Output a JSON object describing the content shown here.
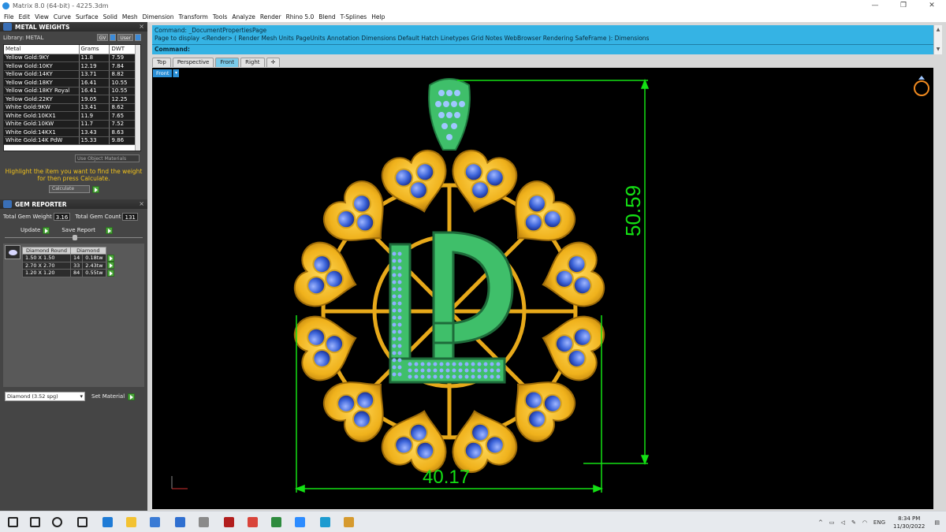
{
  "window": {
    "title": "Matrix 8.0 (64-bit) - 4225.3dm",
    "min": "—",
    "restore": "❐",
    "close": "✕"
  },
  "menu": [
    "File",
    "Edit",
    "View",
    "Curve",
    "Surface",
    "Solid",
    "Mesh",
    "Dimension",
    "Transform",
    "Tools",
    "Analyze",
    "Render",
    "Rhino 5.0",
    "Blend",
    "T-Splines",
    "Help"
  ],
  "metal_weights": {
    "title": "METAL WEIGHTS",
    "library": "Library: METAL",
    "btn_gv": "GV",
    "btn_user": "User",
    "headers": [
      "Metal",
      "Grams",
      "DWT"
    ],
    "rows": [
      [
        "Yellow Gold:9KY",
        "11.8",
        "7.59"
      ],
      [
        "Yellow Gold:10KY",
        "12.19",
        "7.84"
      ],
      [
        "Yellow Gold:14KY",
        "13.71",
        "8.82"
      ],
      [
        "Yellow Gold:18KY",
        "16.41",
        "10.55"
      ],
      [
        "Yellow Gold:18KY Royal",
        "16.41",
        "10.55"
      ],
      [
        "Yellow Gold:22KY",
        "19.05",
        "12.25"
      ],
      [
        "White Gold:9KW",
        "13.41",
        "8.62"
      ],
      [
        "White Gold:10KX1",
        "11.9",
        "7.65"
      ],
      [
        "White Gold:10KW",
        "11.7",
        "7.52"
      ],
      [
        "White Gold:14KX1",
        "13.43",
        "8.63"
      ],
      [
        "White Gold:14K PdW",
        "15.33",
        "9.86"
      ]
    ],
    "use_object": "Use Object Materials",
    "hint": "Highlight the item you want to find the weight for then press Calculate.",
    "calculate": "Calculate"
  },
  "gem_reporter": {
    "title": "GEM REPORTER",
    "total_weight_label": "Total Gem Weight",
    "total_weight": "3.16",
    "total_count_label": "Total Gem Count",
    "total_count": "131",
    "update": "Update",
    "save_report": "Save Report",
    "headers": [
      "Diamond Round",
      "Diamond"
    ],
    "rows": [
      [
        "1.50 X 1.50",
        "14",
        "0.18tw"
      ],
      [
        "2.70 X 2.70",
        "33",
        "2.43tw"
      ],
      [
        "1.20 X 1.20",
        "84",
        "0.55tw"
      ]
    ],
    "material_select": "Diamond    (3.52 spg)",
    "set_material": "Set Material"
  },
  "command": {
    "line1": "Command: _DocumentPropertiesPage",
    "line2": "Page to display <Render> ( Render  Mesh  Units  PageUnits  Annotation  Dimensions  Default  Hatch  Linetypes  Grid  Notes  WebBrowser  Rendering  SafeFrame ): Dimensions",
    "prompt": "Command:"
  },
  "viewport_tabs": [
    "Top",
    "Perspective",
    "Front",
    "Right",
    "✛"
  ],
  "viewport": {
    "label": "Front",
    "dim_height": "50.59",
    "dim_width": "40.17",
    "axis_z": "z",
    "axis_x": "x"
  },
  "colors": {
    "gold": "#f0b21c",
    "stone_blue": "#3b63d8",
    "letter_green": "#3fbf6a",
    "dim_green": "#14e014",
    "cmd_bg": "#35b3e4"
  },
  "taskbar": {
    "icons": [
      "windows-icon",
      "search-icon",
      "cortana-icon",
      "task-view-icon",
      "edge-icon",
      "file-explorer-icon",
      "store-icon",
      "mail-icon",
      "app-icon",
      "app-icon",
      "chrome-icon",
      "excel-icon",
      "zoom-icon",
      "app-icon",
      "rhino-icon"
    ],
    "lang": "ENG",
    "time": "8:34 PM",
    "date": "11/30/2022"
  }
}
